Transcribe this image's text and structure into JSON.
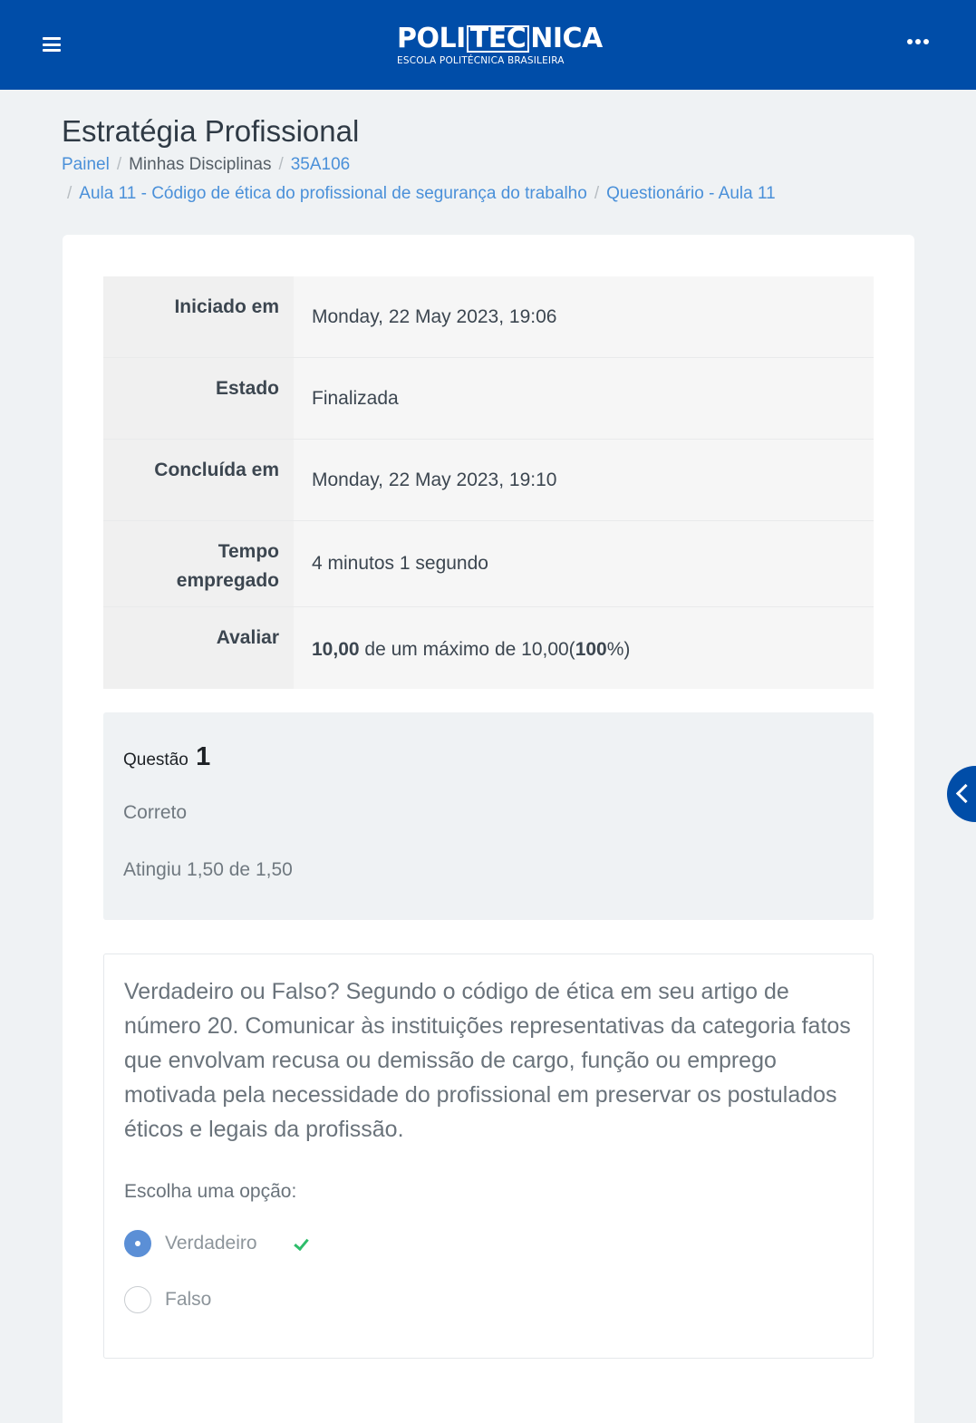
{
  "header": {
    "logo_main_a": "POLI",
    "logo_main_box": "TEC",
    "logo_main_b": "NICA",
    "logo_sub": "ESCOLA POLITÉCNICA BRASILEIRA",
    "menu_icon": "hamburger-icon",
    "more_icon": "more-horizontal-icon",
    "brand_color": "#004da8"
  },
  "page": {
    "title": "Estratégia Profissional"
  },
  "breadcrumb": [
    {
      "label": "Painel",
      "link": true
    },
    {
      "label": "Minhas Disciplinas",
      "link": false
    },
    {
      "label": "35A106",
      "link": true
    },
    {
      "label": "Aula 11 - Código de ética do profissional de segurança do trabalho",
      "link": true
    },
    {
      "label": "Questionário - Aula 11",
      "link": true
    }
  ],
  "summary": {
    "started_label": "Iniciado em",
    "started_value": "Monday, 22 May 2023, 19:06",
    "state_label": "Estado",
    "state_value": "Finalizada",
    "completed_label": "Concluída em",
    "completed_value": "Monday, 22 May 2023, 19:10",
    "time_label_1": "Tempo",
    "time_label_2": "empregado",
    "time_value": "4 minutos 1 segundo",
    "grade_label": "Avaliar",
    "grade_score": "10,00",
    "grade_mid": " de um máximo de 10,00(",
    "grade_percent": "100",
    "grade_end": "%)"
  },
  "question": {
    "number_label": "Questão",
    "number": "1",
    "state": "Correto",
    "mark": "Atingiu 1,50 de 1,50",
    "text": "Verdadeiro ou Falso? Segundo o código de ética em seu artigo de número 20. Comunicar às instituições representativas da categoria fatos que envolvam recusa ou demissão de cargo, função ou emprego motivada pela necessidade do profissional em preservar os postulados éticos e legais da profissão.",
    "prompt": "Escolha uma opção:",
    "options": [
      {
        "label": "Verdadeiro",
        "selected": true,
        "correct": true
      },
      {
        "label": "Falso",
        "selected": false,
        "correct": false
      }
    ],
    "correct_icon": "check-icon",
    "correct_color": "#2ebd6b"
  },
  "drawer": {
    "icon": "chevron-left-icon"
  }
}
